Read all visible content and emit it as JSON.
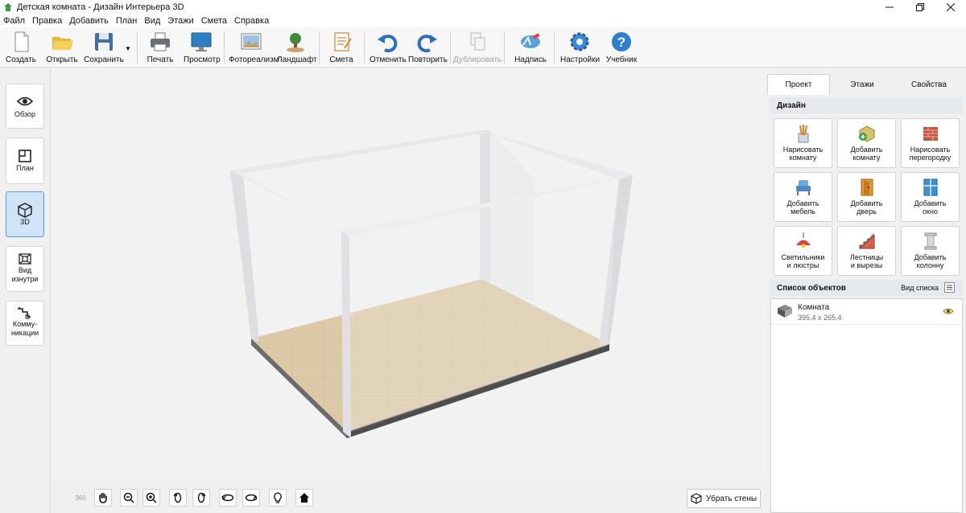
{
  "window": {
    "title": "Детская комната - Дизайн Интерьера 3D"
  },
  "menu": [
    "Файл",
    "Правка",
    "Добавить",
    "План",
    "Вид",
    "Этажи",
    "Смета",
    "Справка"
  ],
  "toolbar": {
    "create": "Создать",
    "open": "Открыть",
    "save": "Сохранить",
    "print": "Печать",
    "preview": "Просмотр",
    "photorealism": "Фотореализм",
    "landscape": "Ландшафт",
    "estimate": "Смета",
    "undo": "Отменить",
    "redo": "Повторить",
    "duplicate": "Дублировать",
    "caption": "Надпись",
    "settings": "Настройки",
    "tutorial": "Учебник"
  },
  "sidebar": {
    "overview": "Обзор",
    "plan": "План",
    "view3d": "3D",
    "inside_1": "Вид",
    "inside_2": "изнутри",
    "comm_1": "Комму-",
    "comm_2": "никации"
  },
  "bottombar": {
    "remove_walls": "Убрать стены",
    "rotate360": "360"
  },
  "panel": {
    "tabs": [
      "Проект",
      "Этажи",
      "Свойства"
    ],
    "design_header": "Дизайн",
    "tools": [
      {
        "l1": "Нарисовать",
        "l2": "комнату"
      },
      {
        "l1": "Добавить",
        "l2": "комнату"
      },
      {
        "l1": "Нарисовать",
        "l2": "перегородку"
      },
      {
        "l1": "Добавить",
        "l2": "мебель"
      },
      {
        "l1": "Добавить",
        "l2": "дверь"
      },
      {
        "l1": "Добавить",
        "l2": "окно"
      },
      {
        "l1": "Светильники",
        "l2": "и люстры"
      },
      {
        "l1": "Лестницы",
        "l2": "и вырезы"
      },
      {
        "l1": "Добавить",
        "l2": "колонну"
      }
    ],
    "objects_header": "Список объектов",
    "list_view": "Вид списка",
    "objects": [
      {
        "name": "Комната",
        "size": "395.4 x 265.4"
      }
    ]
  },
  "colors": {
    "accent": "#5b9bd5",
    "floor": "#dcc9a7",
    "wall": "#e7e7e9"
  }
}
